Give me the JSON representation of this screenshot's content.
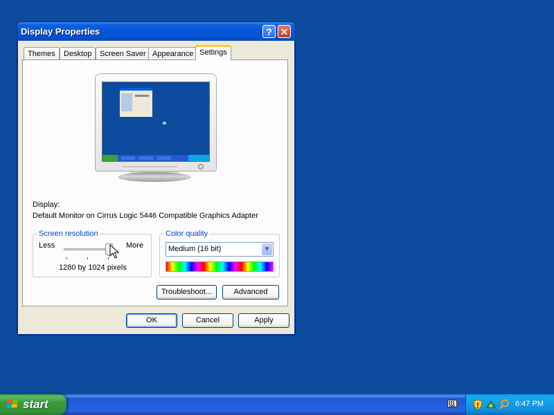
{
  "window": {
    "title": "Display Properties",
    "help_label": "?",
    "close_label": "✕"
  },
  "tabs": [
    {
      "label": "Themes"
    },
    {
      "label": "Desktop"
    },
    {
      "label": "Screen Saver"
    },
    {
      "label": "Appearance"
    },
    {
      "label": "Settings",
      "active": true
    }
  ],
  "settings": {
    "display_label": "Display:",
    "display_value": "Default Monitor on Cirrus Logic 5446 Compatible Graphics Adapter",
    "resolution": {
      "legend": "Screen resolution",
      "less": "Less",
      "more": "More",
      "value": "1280 by 1024 pixels",
      "slider_level": 1.0
    },
    "color_quality": {
      "legend": "Color quality",
      "selected": "Medium (16 bit)"
    },
    "troubleshoot_label": "Troubleshoot...",
    "advanced_label": "Advanced"
  },
  "dialog_buttons": {
    "ok": "OK",
    "cancel": "Cancel",
    "apply": "Apply"
  },
  "taskbar": {
    "start_label": "start",
    "clock": "6:47 PM"
  },
  "colors": {
    "desktop": "#0c4b9d",
    "titlebar": "#0656d8",
    "legend_text": "#0046d5",
    "start_green": "#3a9a3a"
  }
}
